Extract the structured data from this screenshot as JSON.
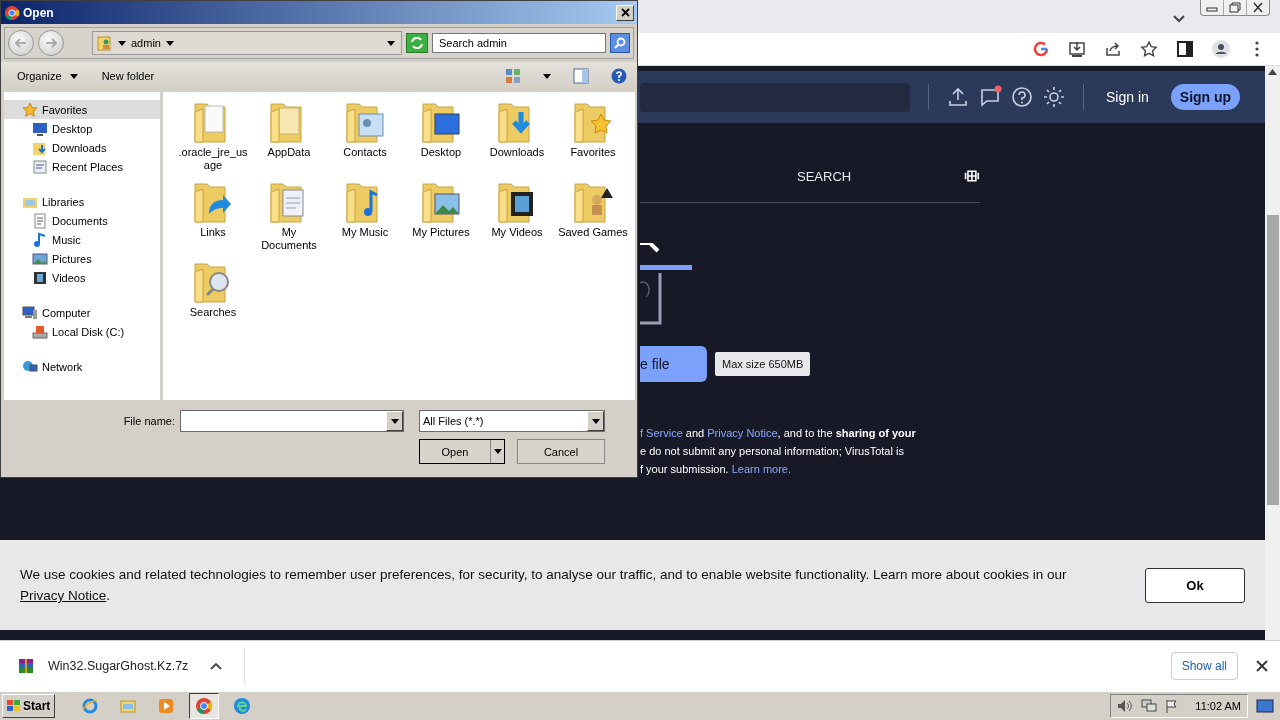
{
  "browser": {
    "toolbar_icons": [
      {
        "kind": "google"
      },
      {
        "kind": "install"
      },
      {
        "kind": "share"
      },
      {
        "kind": "star"
      },
      {
        "kind": "sidebar"
      },
      {
        "kind": "profile"
      },
      {
        "kind": "menu"
      }
    ],
    "site": {
      "header_icons": [
        {
          "kind": "upload",
          "badge": false
        },
        {
          "kind": "chat",
          "badge": true
        },
        {
          "kind": "help",
          "badge": false
        },
        {
          "kind": "theme",
          "badge": false
        }
      ],
      "sign_in": "Sign in",
      "sign_up": "Sign up",
      "tab": "SEARCH",
      "upload_button": "e file",
      "tooltip": "Max size 650MB",
      "terms": [
        [
          {
            "kind": "link",
            "text": "f Service"
          },
          {
            "kind": "text",
            "text": " and "
          },
          {
            "kind": "link",
            "text": "Privacy Notice"
          },
          {
            "kind": "text",
            "text": ", and to the **sharing of your**"
          }
        ],
        [
          {
            "kind": "text",
            "text": "e do not submit any personal information; VirusTotal is"
          }
        ],
        [
          {
            "kind": "text",
            "text": "f your submission. "
          },
          {
            "kind": "link",
            "text": "Learn more."
          }
        ]
      ]
    },
    "cookie": {
      "text": "We use cookies and related technologies to remember user preferences, for security, to analyse our traffic, and to enable website functionality. Learn more about cookies in our ",
      "link": "Privacy Notice",
      "end": ".",
      "button": "Ok"
    }
  },
  "download_bar": {
    "file": "Win32.SugarGhost.Kz.7z",
    "show_all": "Show all"
  },
  "dialog": {
    "title": "Open",
    "location": "admin",
    "search_placeholder": "Search admin",
    "organize": "Organize",
    "new_folder": "New folder",
    "nav": [
      {
        "label": "Favorites",
        "kind": "star",
        "selected": true,
        "children": [
          {
            "label": "Desktop",
            "kind": "desktop",
            "selected": false
          },
          {
            "label": "Downloads",
            "kind": "downloads",
            "selected": false
          },
          {
            "label": "Recent Places",
            "kind": "recent",
            "selected": false
          }
        ]
      },
      {
        "label": "Libraries",
        "kind": "library",
        "selected": false,
        "children": [
          {
            "label": "Documents",
            "kind": "documents",
            "selected": false
          },
          {
            "label": "Music",
            "kind": "music",
            "selected": false
          },
          {
            "label": "Pictures",
            "kind": "pictures",
            "selected": false
          },
          {
            "label": "Videos",
            "kind": "videos",
            "selected": false
          }
        ]
      },
      {
        "label": "Computer",
        "kind": "computer",
        "selected": false,
        "children": [
          {
            "label": "Local Disk (C:)",
            "kind": "disk",
            "selected": false
          }
        ]
      },
      {
        "label": "Network",
        "kind": "network",
        "selected": false
      }
    ],
    "files": [
      {
        "label": ".oracle_jre_usage",
        "kind": "plain"
      },
      {
        "label": "AppData",
        "kind": "hidden"
      },
      {
        "label": "Contacts",
        "kind": "contacts"
      },
      {
        "label": "Desktop",
        "kind": "desktop"
      },
      {
        "label": "Downloads",
        "kind": "downloads"
      },
      {
        "label": "Favorites",
        "kind": "favorites"
      },
      {
        "label": "Links",
        "kind": "links"
      },
      {
        "label": "My Documents",
        "kind": "documents"
      },
      {
        "label": "My Music",
        "kind": "music"
      },
      {
        "label": "My Pictures",
        "kind": "pictures"
      },
      {
        "label": "My Videos",
        "kind": "videos"
      },
      {
        "label": "Saved Games",
        "kind": "games"
      },
      {
        "label": "Searches",
        "kind": "searches"
      }
    ],
    "file_name_label": "File name:",
    "filter": "All Files (*.*)",
    "open": "Open",
    "cancel": "Cancel"
  },
  "taskbar": {
    "start": "Start",
    "apps": [
      {
        "kind": "ie",
        "selected": false
      },
      {
        "kind": "explorer",
        "selected": false
      },
      {
        "kind": "media",
        "selected": false
      },
      {
        "kind": "chrome",
        "selected": true
      },
      {
        "kind": "edge",
        "selected": false
      }
    ],
    "time": "11:02 AM"
  }
}
